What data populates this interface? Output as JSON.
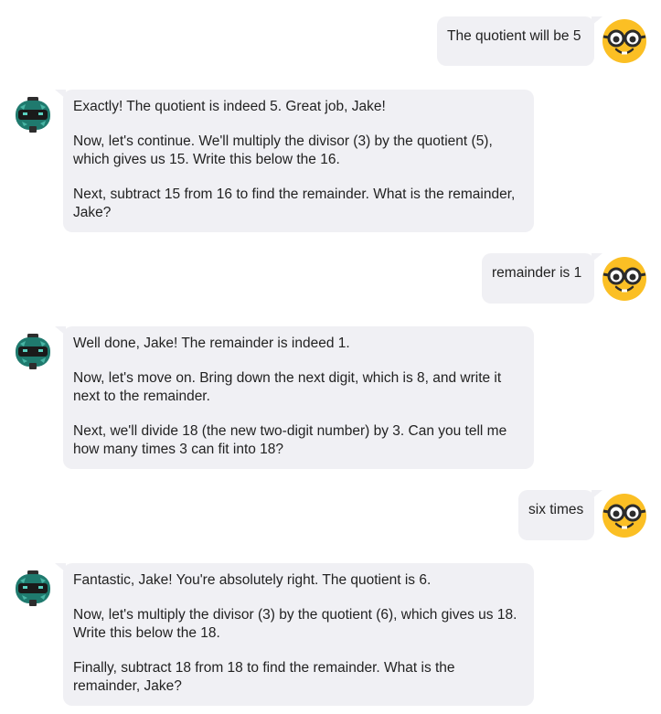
{
  "conversation": {
    "messages": [
      {
        "role": "user",
        "avatar": "nerd-face-icon",
        "paragraphs": [
          "The quotient will be 5"
        ]
      },
      {
        "role": "bot",
        "avatar": "robot-icon",
        "paragraphs": [
          "Exactly! The quotient is indeed 5. Great job, Jake!",
          "Now, let's continue. We'll multiply the divisor (3) by the quotient (5), which gives us 15. Write this below the 16.",
          "Next, subtract 15 from 16 to find the remainder. What is the remainder, Jake?"
        ]
      },
      {
        "role": "user",
        "avatar": "nerd-face-icon",
        "paragraphs": [
          "remainder is 1"
        ]
      },
      {
        "role": "bot",
        "avatar": "robot-icon",
        "paragraphs": [
          "Well done, Jake! The remainder is indeed 1.",
          "Now, let's move on. Bring down the next digit, which is 8, and write it next to the remainder.",
          "Next, we'll divide 18 (the new two-digit number) by 3. Can you tell me how many times 3 can fit into 18?"
        ]
      },
      {
        "role": "user",
        "avatar": "nerd-face-icon",
        "paragraphs": [
          "six times"
        ]
      },
      {
        "role": "bot",
        "avatar": "robot-icon",
        "paragraphs": [
          "Fantastic, Jake! You're absolutely right. The quotient is 6.",
          "Now, let's multiply the divisor (3) by the quotient (6), which gives us 18. Write this below the 18.",
          "Finally, subtract 18 from 18 to find the remainder. What is the remainder, Jake?"
        ]
      }
    ]
  },
  "colors": {
    "bubble_background": "#f0f0f4",
    "text": "#222222",
    "user_avatar_face": "#fbbf24",
    "bot_avatar_body": "#1f7a6e"
  }
}
